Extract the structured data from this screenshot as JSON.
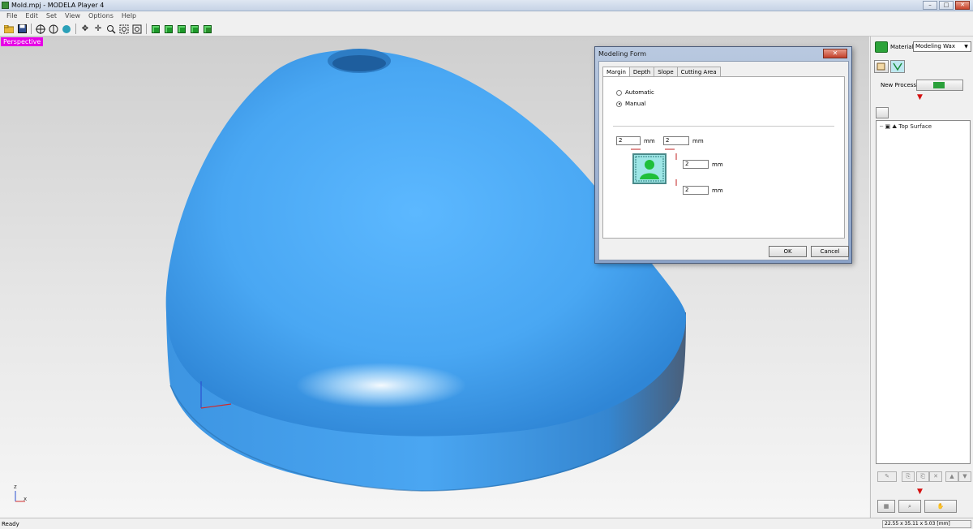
{
  "window": {
    "title": "Mold.mpj - MODELA Player 4",
    "minimize": "–",
    "maximize": "□",
    "close": "✕"
  },
  "menu": [
    "File",
    "Edit",
    "Set",
    "View",
    "Options",
    "Help"
  ],
  "viewport": {
    "mode_label": "Perspective",
    "axis_z": "z",
    "axis_x": "x",
    "model_color": "#4ba8f5"
  },
  "dialog": {
    "title": "Modeling Form",
    "close_label": "✕",
    "tabs": [
      "Margin",
      "Depth",
      "Slope",
      "Cutting Area"
    ],
    "active_tab": "Margin",
    "radio_automatic": "Automatic",
    "radio_manual": "Manual",
    "selected_radio": "Manual",
    "margin_left": "2",
    "margin_right": "2",
    "margin_top": "2",
    "margin_bottom": "2",
    "unit": "mm",
    "ok": "OK",
    "cancel": "Cancel"
  },
  "panel": {
    "material_label": "Material",
    "material_value": "Modeling Wax",
    "new_process_label": "New Process",
    "tree_item": "Top Surface"
  },
  "status": {
    "left": "Ready",
    "dimensions": "22.55 x 35.11 x 5.03 [mm]"
  }
}
